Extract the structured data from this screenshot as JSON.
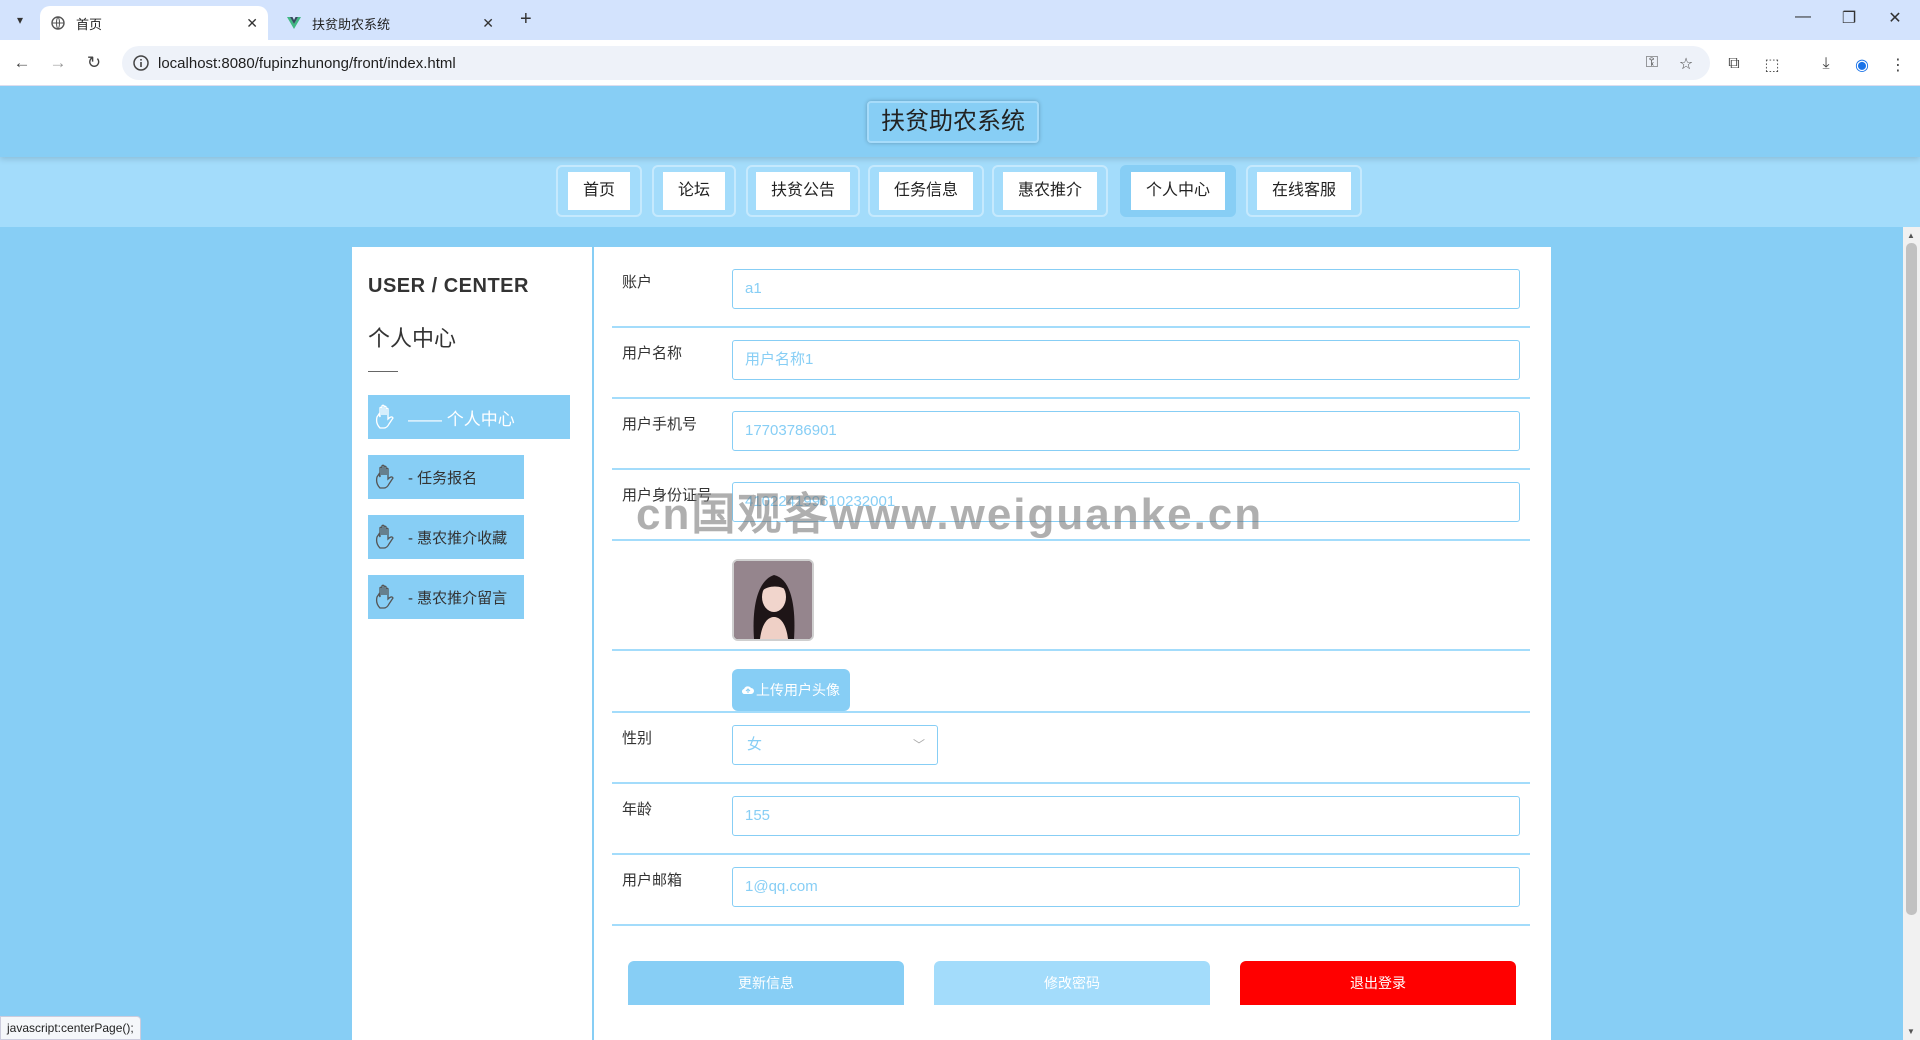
{
  "browser": {
    "tabs": [
      {
        "title": "首页",
        "active": true
      },
      {
        "title": "扶贫助农系统",
        "active": false
      }
    ],
    "url": "localhost:8080/fupinzhunong/front/index.html",
    "status_text": "javascript:centerPage();"
  },
  "site": {
    "title": "扶贫助农系统",
    "nav": [
      "首页",
      "论坛",
      "扶贫公告",
      "任务信息",
      "惠农推介",
      "个人中心",
      "在线客服"
    ],
    "nav_active": "个人中心"
  },
  "sidebar": {
    "en_title": "USER / CENTER",
    "cn_title": "个人中心",
    "items": [
      {
        "label": "—— 个人中心",
        "active": true
      },
      {
        "label": "- 任务报名",
        "active": false
      },
      {
        "label": "- 惠农推介收藏",
        "active": false
      },
      {
        "label": "- 惠农推介留言",
        "active": false
      }
    ]
  },
  "form": {
    "account": {
      "label": "账户",
      "value": "a1"
    },
    "username": {
      "label": "用户名称",
      "value": "用户名称1"
    },
    "phone": {
      "label": "用户手机号",
      "value": "17703786901"
    },
    "idcard": {
      "label": "用户身份证号",
      "value": "410224199610232001"
    },
    "upload_label": "上传用户头像",
    "gender": {
      "label": "性别",
      "value": "女"
    },
    "age": {
      "label": "年龄",
      "value": "155"
    },
    "email": {
      "label": "用户邮箱",
      "value": "1@qq.com"
    }
  },
  "buttons": {
    "update": "更新信息",
    "change_password": "修改密码",
    "logout": "退出登录"
  },
  "watermark": "cn国观客www.weiguanke.cn",
  "colors": {
    "primary": "#87cef5",
    "light": "#a3dcfb",
    "danger": "#ff0000"
  }
}
